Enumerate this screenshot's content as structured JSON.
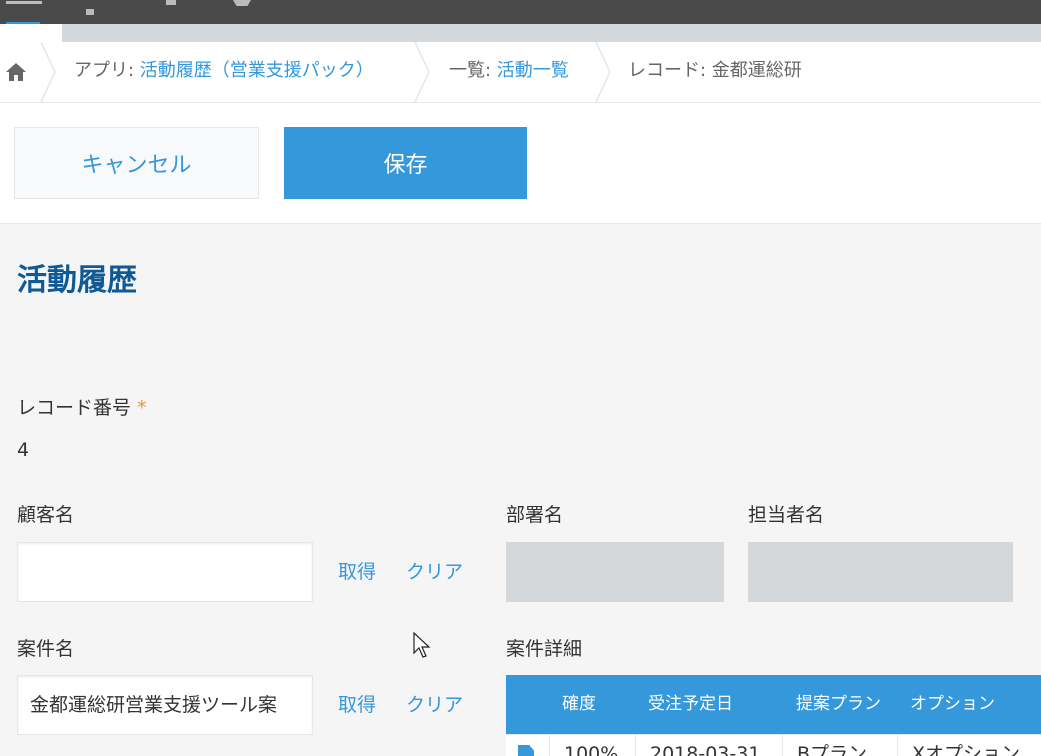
{
  "breadcrumb": {
    "app_prefix": "アプリ: ",
    "app_name": "活動履歴（営業支援パック）",
    "view_prefix": "一覧: ",
    "view_name": "活動一覧",
    "record": "レコード: 金都運総研"
  },
  "toolbar": {
    "cancel_label": "キャンセル",
    "save_label": "保存"
  },
  "app_title": "活動履歴",
  "fields": {
    "record_number": {
      "label": "レコード番号",
      "required_mark": "*",
      "value": "4"
    },
    "customer_name": {
      "label": "顧客名",
      "value": "",
      "get_label": "取得",
      "clear_label": "クリア"
    },
    "department": {
      "label": "部署名",
      "value": ""
    },
    "person_in_charge": {
      "label": "担当者名",
      "value": ""
    },
    "project_name": {
      "label": "案件名",
      "value": "金都運総研営業支援ツール案",
      "get_label": "取得",
      "clear_label": "クリア"
    },
    "project_details": {
      "label": "案件詳細",
      "columns": [
        "確度",
        "受注予定日",
        "提案プラン",
        "オプション"
      ],
      "rows": [
        [
          "100%",
          "2018-03-31",
          "Bプラン",
          "Xオプション"
        ]
      ]
    }
  },
  "colors": {
    "accent": "#3498db",
    "title": "#0f5a96",
    "required": "#e49545",
    "readonly_bg": "#d4d8da"
  },
  "icons": [
    "menu-icon",
    "home-icon",
    "document-icon",
    "mouse-cursor-icon"
  ]
}
